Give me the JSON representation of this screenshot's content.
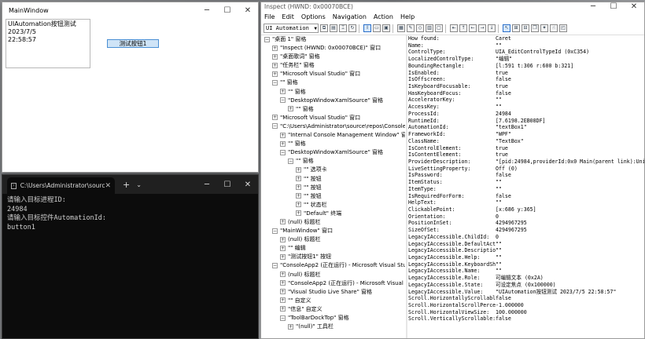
{
  "main_window": {
    "title": "MainWindow",
    "text_line1": "UIAutomation按钮测试  2023/7/5",
    "text_line2": "22:58:57",
    "button_label": "测试按钮1"
  },
  "terminal": {
    "tab_title": "C:\\Users\\Administrator\\sourc",
    "lines": [
      "请输入目标进程ID:",
      "24984",
      "请输入目标控件AutomationId:",
      "button1"
    ]
  },
  "inspect": {
    "title": "Inspect  (HWND: 0x00070BCE)",
    "menu": [
      "File",
      "Edit",
      "Options",
      "Navigation",
      "Action",
      "Help"
    ],
    "mode_combo": "UI Automation",
    "tree": [
      {
        "d": 0,
        "e": "-",
        "t": "\"桌面 1\" 窗格"
      },
      {
        "d": 1,
        "e": "+",
        "t": "\"Inspect  (HWND: 0x00070BCE)\" 窗口"
      },
      {
        "d": 1,
        "e": "+",
        "t": "\"桌面歌词\" 窗格"
      },
      {
        "d": 1,
        "e": "+",
        "t": "\"任务栏\" 窗格"
      },
      {
        "d": 1,
        "e": "+",
        "t": "\"Microsoft Visual Studio\" 窗口"
      },
      {
        "d": 1,
        "e": "-",
        "t": "\"\" 窗格"
      },
      {
        "d": 2,
        "e": "+",
        "t": "\"\" 窗格"
      },
      {
        "d": 2,
        "e": "-",
        "t": "\"DesktopWindowXamlSource\" 窗格"
      },
      {
        "d": 3,
        "e": "+",
        "t": "\"\" 窗格"
      },
      {
        "d": 1,
        "e": "+",
        "t": "\"Microsoft Visual Studio\" 窗口"
      },
      {
        "d": 1,
        "e": "-",
        "t": "\"C:\\Users\\Administrator\\source\\repos\\Console"
      },
      {
        "d": 2,
        "e": "+",
        "t": "\"Internal Console Management Window\" 窗"
      },
      {
        "d": 2,
        "e": "+",
        "t": "\"\" 窗格"
      },
      {
        "d": 2,
        "e": "-",
        "t": "\"DesktopWindowXamlSource\" 窗格"
      },
      {
        "d": 3,
        "e": "-",
        "t": "\"\" 窗格"
      },
      {
        "d": 4,
        "e": "+",
        "t": "\"\" 选项卡"
      },
      {
        "d": 4,
        "e": "+",
        "t": "\"\" 按钮"
      },
      {
        "d": 4,
        "e": "+",
        "t": "\"\" 按钮"
      },
      {
        "d": 4,
        "e": "+",
        "t": "\"\" 按钮"
      },
      {
        "d": 4,
        "e": "+",
        "t": "\"\" 状态栏"
      },
      {
        "d": 4,
        "e": "+",
        "t": "\"Default\" 终端"
      },
      {
        "d": 2,
        "e": "+",
        "t": "(null) 标题栏"
      },
      {
        "d": 1,
        "e": "-",
        "t": "\"MainWindow\" 窗口"
      },
      {
        "d": 2,
        "e": "+",
        "t": "(null) 标题栏"
      },
      {
        "d": 2,
        "e": "+",
        "t": "\"\" 编辑"
      },
      {
        "d": 2,
        "e": "+",
        "t": "\"测试按钮1\" 按钮"
      },
      {
        "d": 1,
        "e": "-",
        "t": "\"ConsoleApp2 (正在运行) - Microsoft Visual Stu"
      },
      {
        "d": 2,
        "e": "+",
        "t": "(null) 标题栏"
      },
      {
        "d": 2,
        "e": "+",
        "t": "\"ConsoleApp2 (正在运行) - Microsoft Visual"
      },
      {
        "d": 2,
        "e": "+",
        "t": "\"Visual Studio Live Share\" 窗格"
      },
      {
        "d": 2,
        "e": "+",
        "t": "\"\" 自定义"
      },
      {
        "d": 2,
        "e": "+",
        "t": "\"信息\" 自定义"
      },
      {
        "d": 2,
        "e": "-",
        "t": "\"ToolBarDockTop\" 窗格"
      },
      {
        "d": 3,
        "e": "+",
        "t": "\"(null)\" 工具栏"
      }
    ],
    "properties": [
      [
        "How found:",
        "Caret"
      ],
      [
        "Name:",
        "\"\""
      ],
      [
        "ControlType:",
        "UIA_EditControlTypeId (0xC354)"
      ],
      [
        "LocalizedControlType:",
        "\"编辑\""
      ],
      [
        "BoundingRectangle:",
        "[l:591 t:306 r:600 b:321]"
      ],
      [
        "IsEnabled:",
        "true"
      ],
      [
        "IsOffscreen:",
        "false"
      ],
      [
        "IsKeyboardFocusable:",
        "true"
      ],
      [
        "HasKeyboardFocus:",
        "false"
      ],
      [
        "AcceleratorKey:",
        "\"\""
      ],
      [
        "AccessKey:",
        "\"\""
      ],
      [
        "ProcessId:",
        "24984"
      ],
      [
        "RuntimeId:",
        "[7.6198.2EB08DF]"
      ],
      [
        "AutomationId:",
        "\"textBox1\""
      ],
      [
        "FrameworkId:",
        "\"WPF\""
      ],
      [
        "ClassName:",
        "\"TextBox\""
      ],
      [
        "IsControlElement:",
        "true"
      ],
      [
        "IsContentElement:",
        "true"
      ],
      [
        "ProviderDescription:",
        "\"[pid:24984,providerId:0x0 Main(parent link):Unidenti"
      ],
      [
        "LiveSettingProperty:",
        "Off (0)"
      ],
      [
        "IsPassword:",
        "false"
      ],
      [
        "ItemStatus:",
        "\"\""
      ],
      [
        "ItemType:",
        "\"\""
      ],
      [
        "IsRequiredForForm:",
        "false"
      ],
      [
        "HelpText:",
        "\"\""
      ],
      [
        "ClickablePoint:",
        "[x:686 y:365]"
      ],
      [
        "Orientation:",
        "0"
      ],
      [
        "PositionInSet:",
        "4294967295"
      ],
      [
        "SizeOfSet:",
        "4294967295"
      ],
      [
        "LegacyIAccessible.ChildId:",
        "0"
      ],
      [
        "LegacyIAccessible.DefaultAction:",
        "\"\""
      ],
      [
        "LegacyIAccessible.Description:",
        "\"\""
      ],
      [
        "LegacyIAccessible.Help:",
        "\"\""
      ],
      [
        "LegacyIAccessible.KeyboardShortcut:",
        "\"\""
      ],
      [
        "LegacyIAccessible.Name:",
        "\"\""
      ],
      [
        "LegacyIAccessible.Role:",
        "可编辑文本 (0x2A)"
      ],
      [
        "LegacyIAccessible.State:",
        "可设定焦点 (0x100000)"
      ],
      [
        "LegacyIAccessible.Value:",
        "\"UIAutomation按钮测试  2023/7/5 22:58:57\""
      ],
      [
        "Scroll.HorizontallyScrollable:",
        "false"
      ],
      [
        "Scroll.HorizontalScrollPercent:",
        "-1.000000"
      ],
      [
        "Scroll.HorizontalViewSize:",
        "100.000000"
      ],
      [
        "Scroll.VerticallyScrollable:",
        "false"
      ]
    ]
  },
  "colors": {
    "terminal_bg": "#0c0c0c",
    "button_bg": "#cfe4f7",
    "button_border": "#4a8fd4"
  }
}
